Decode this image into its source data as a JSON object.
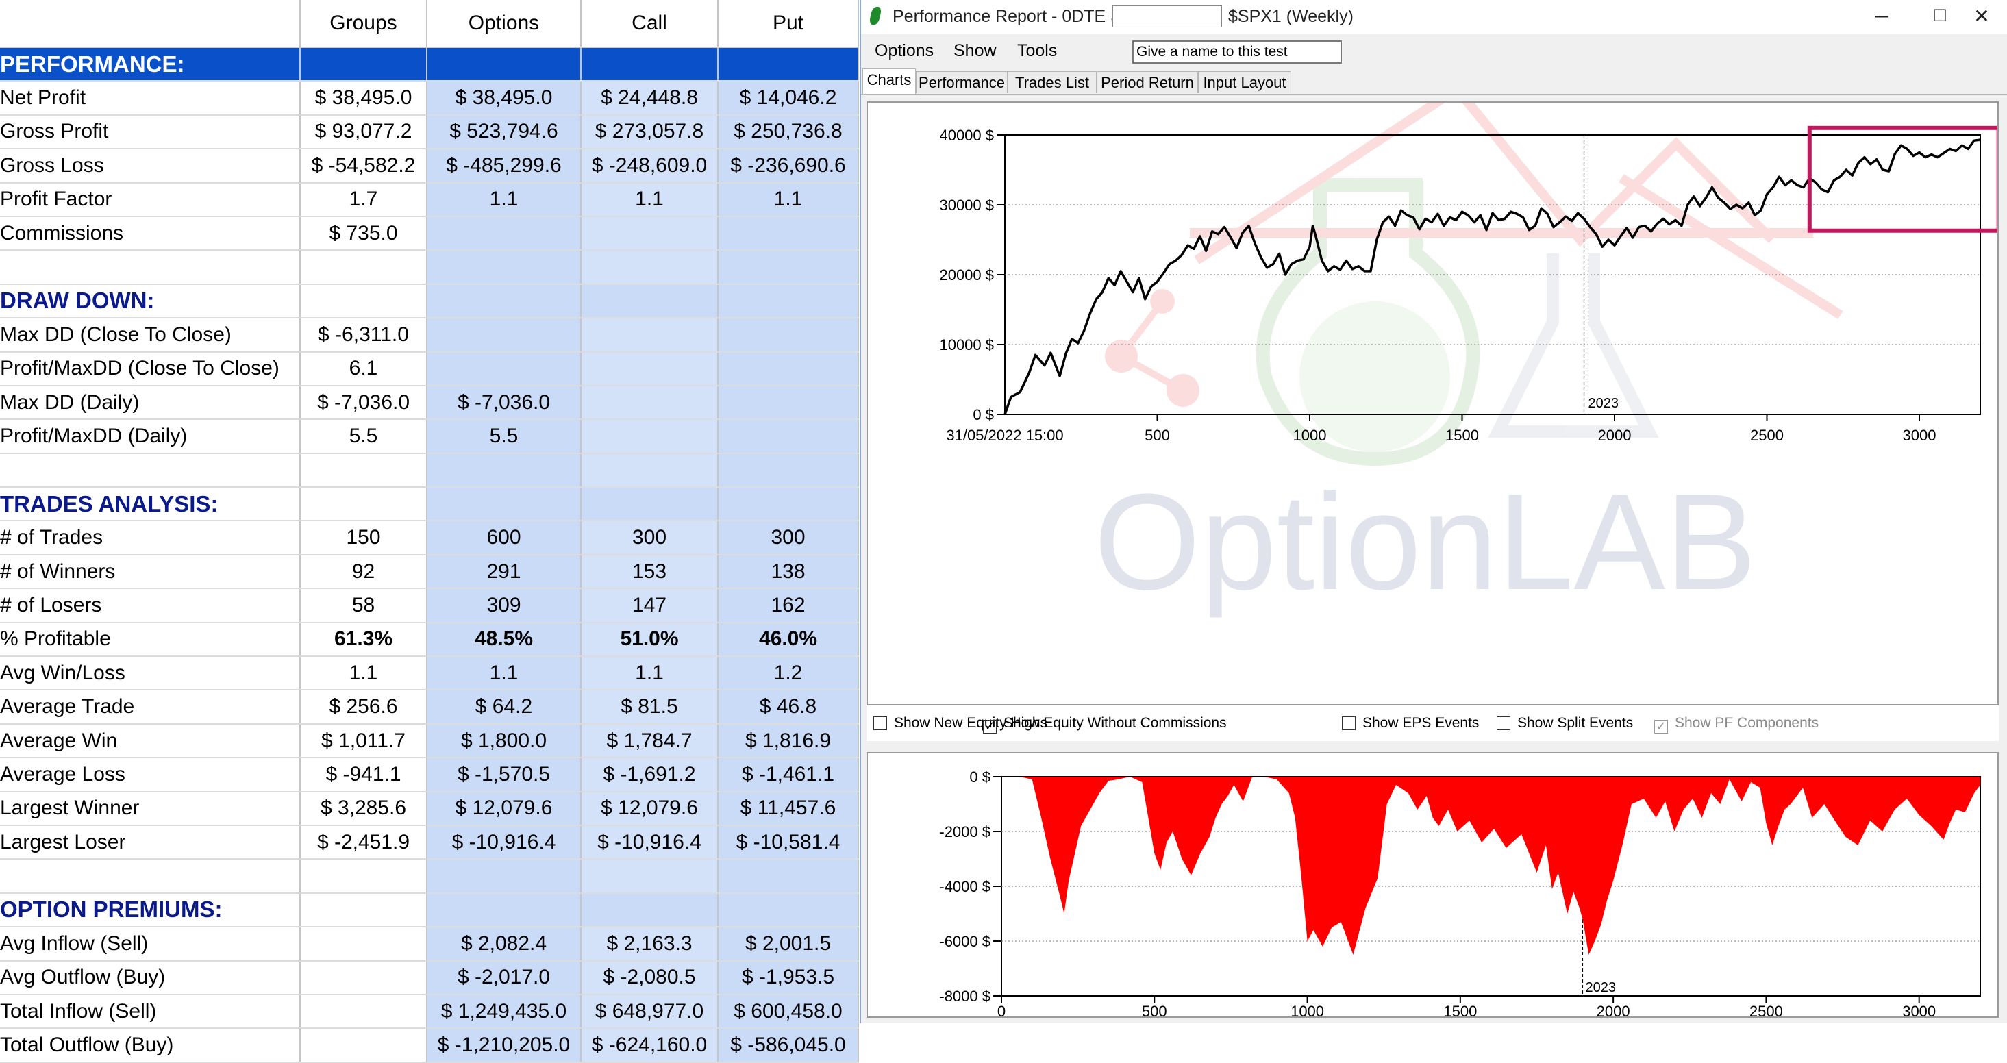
{
  "table": {
    "columns": [
      "",
      "Groups",
      "Options",
      "Call",
      "Put"
    ],
    "rows": [
      {
        "type": "section",
        "style": "perf",
        "label": "PERFORMANCE:",
        "cells": [
          "",
          "",
          "",
          ""
        ]
      },
      {
        "label": "Net Profit",
        "cells": [
          {
            "v": "$ 38,495.0",
            "c": "pos"
          },
          {
            "v": "$ 38,495.0",
            "c": "pos"
          },
          {
            "v": "$ 24,448.8",
            "c": "pos"
          },
          {
            "v": "$ 14,046.2",
            "c": "pos"
          }
        ]
      },
      {
        "label": "Gross Profit",
        "cells": [
          {
            "v": "$ 93,077.2",
            "c": "pos"
          },
          {
            "v": "$ 523,794.6",
            "c": "pos"
          },
          {
            "v": "$ 273,057.8",
            "c": "pos"
          },
          {
            "v": "$ 250,736.8",
            "c": "pos"
          }
        ]
      },
      {
        "label": "Gross Loss",
        "cells": [
          {
            "v": "$ -54,582.2",
            "c": "neg"
          },
          {
            "v": "$ -485,299.6",
            "c": "neg"
          },
          {
            "v": "$ -248,609.0",
            "c": "neg"
          },
          {
            "v": "$ -236,690.6",
            "c": "neg"
          }
        ]
      },
      {
        "label": "Profit Factor",
        "cells": [
          {
            "v": "1.7",
            "c": "pos"
          },
          {
            "v": "1.1",
            "c": "pos"
          },
          {
            "v": "1.1",
            "c": "pos"
          },
          {
            "v": "1.1",
            "c": "pos"
          }
        ]
      },
      {
        "label": "Commissions",
        "cells": [
          {
            "v": "$ 735.0",
            "c": "neg"
          },
          {
            "v": ""
          },
          {
            "v": ""
          },
          {
            "v": ""
          }
        ]
      },
      {
        "type": "blank",
        "label": "",
        "cells": [
          "",
          "",
          "",
          ""
        ]
      },
      {
        "type": "section",
        "label": "DRAW DOWN:",
        "cells": [
          "",
          "",
          "",
          ""
        ]
      },
      {
        "label": "Max DD (Close To Close)",
        "cells": [
          {
            "v": "$ -6,311.0"
          },
          {
            "v": ""
          },
          {
            "v": ""
          },
          {
            "v": ""
          }
        ]
      },
      {
        "label": "Profit/MaxDD (Close To Close)",
        "cells": [
          {
            "v": "6.1"
          },
          {
            "v": ""
          },
          {
            "v": ""
          },
          {
            "v": ""
          }
        ]
      },
      {
        "label": "Max DD (Daily)",
        "cells": [
          {
            "v": "$ -7,036.0"
          },
          {
            "v": "$ -7,036.0"
          },
          {
            "v": ""
          },
          {
            "v": ""
          }
        ]
      },
      {
        "label": "Profit/MaxDD (Daily)",
        "cells": [
          {
            "v": "5.5"
          },
          {
            "v": "5.5"
          },
          {
            "v": ""
          },
          {
            "v": ""
          }
        ]
      },
      {
        "type": "blank",
        "label": "",
        "cells": [
          "",
          "",
          "",
          ""
        ]
      },
      {
        "type": "section",
        "label": "TRADES ANALYSIS:",
        "cells": [
          "",
          "",
          "",
          ""
        ]
      },
      {
        "label": "# of Trades",
        "cells": [
          {
            "v": "150"
          },
          {
            "v": "600"
          },
          {
            "v": "300"
          },
          {
            "v": "300"
          }
        ]
      },
      {
        "label": "# of Winners",
        "cells": [
          {
            "v": "92"
          },
          {
            "v": "291"
          },
          {
            "v": "153"
          },
          {
            "v": "138"
          }
        ]
      },
      {
        "label": "# of Losers",
        "cells": [
          {
            "v": "58"
          },
          {
            "v": "309"
          },
          {
            "v": "147"
          },
          {
            "v": "162"
          }
        ]
      },
      {
        "label": "% Profitable",
        "cells": [
          {
            "v": "61.3%",
            "c": "bold"
          },
          {
            "v": "48.5%",
            "c": "bold"
          },
          {
            "v": "51.0%",
            "c": "bold"
          },
          {
            "v": "46.0%",
            "c": "bold"
          }
        ]
      },
      {
        "label": "Avg Win/Loss",
        "cells": [
          {
            "v": "1.1",
            "c": "pos"
          },
          {
            "v": "1.1",
            "c": "pos"
          },
          {
            "v": "1.1",
            "c": "pos"
          },
          {
            "v": "1.2",
            "c": "pos"
          }
        ]
      },
      {
        "label": "Average Trade",
        "cells": [
          {
            "v": "$ 256.6",
            "c": "pos"
          },
          {
            "v": "$ 64.2",
            "c": "pos"
          },
          {
            "v": "$ 81.5",
            "c": "pos"
          },
          {
            "v": "$ 46.8",
            "c": "pos"
          }
        ]
      },
      {
        "label": "Average Win",
        "cells": [
          {
            "v": "$ 1,011.7",
            "c": "pos"
          },
          {
            "v": "$ 1,800.0",
            "c": "pos"
          },
          {
            "v": "$ 1,784.7",
            "c": "pos"
          },
          {
            "v": "$ 1,816.9",
            "c": "pos"
          }
        ]
      },
      {
        "label": "Average Loss",
        "cells": [
          {
            "v": "$ -941.1",
            "c": "neg"
          },
          {
            "v": "$ -1,570.5",
            "c": "neg"
          },
          {
            "v": "$ -1,691.2",
            "c": "neg"
          },
          {
            "v": "$ -1,461.1",
            "c": "neg"
          }
        ]
      },
      {
        "label": "Largest Winner",
        "cells": [
          {
            "v": "$ 3,285.6",
            "c": "pos"
          },
          {
            "v": "$ 12,079.6",
            "c": "pos"
          },
          {
            "v": "$ 12,079.6",
            "c": "pos"
          },
          {
            "v": "$ 11,457.6",
            "c": "pos"
          }
        ]
      },
      {
        "label": "Largest Loser",
        "cells": [
          {
            "v": "$ -2,451.9",
            "c": "neg"
          },
          {
            "v": "$ -10,916.4",
            "c": "neg"
          },
          {
            "v": "$ -10,916.4",
            "c": "neg"
          },
          {
            "v": "$ -10,581.4",
            "c": "neg"
          }
        ]
      },
      {
        "type": "blank",
        "label": "",
        "cells": [
          "",
          "",
          "",
          ""
        ]
      },
      {
        "type": "section",
        "label": "OPTION PREMIUMS:",
        "cells": [
          "",
          "",
          "",
          ""
        ]
      },
      {
        "label": "Avg Inflow (Sell)",
        "cells": [
          {
            "v": ""
          },
          {
            "v": "$ 2,082.4",
            "c": "pos"
          },
          {
            "v": "$ 2,163.3",
            "c": "pos"
          },
          {
            "v": "$ 2,001.5",
            "c": "pos"
          }
        ]
      },
      {
        "label": "Avg Outflow (Buy)",
        "cells": [
          {
            "v": ""
          },
          {
            "v": "$ -2,017.0",
            "c": "neg"
          },
          {
            "v": "$ -2,080.5",
            "c": "neg"
          },
          {
            "v": "$ -1,953.5",
            "c": "neg"
          }
        ]
      },
      {
        "label": "Total Inflow (Sell)",
        "cells": [
          {
            "v": ""
          },
          {
            "v": "$ 1,249,435.0",
            "c": "pos"
          },
          {
            "v": "$ 648,977.0",
            "c": "pos"
          },
          {
            "v": "$ 600,458.0",
            "c": "pos"
          }
        ]
      },
      {
        "label": "Total Outflow (Buy)",
        "cells": [
          {
            "v": ""
          },
          {
            "v": "$ -1,210,205.0",
            "c": "neg"
          },
          {
            "v": "$ -624,160.0",
            "c": "neg"
          },
          {
            "v": "$ -586,045.0",
            "c": "neg"
          }
        ]
      }
    ]
  },
  "window": {
    "title": "Performance Report - 0DTE SPX",
    "title_suffix": "$SPX1 (Weekly)",
    "minimize": "─",
    "maximize": "☐",
    "close": "✕",
    "menu": [
      "Options",
      "Show",
      "Tools"
    ],
    "test_name": "Give a name to this test",
    "tabs": [
      "Charts",
      "Performance",
      "Trades List",
      "Period Return",
      "Input Layout"
    ],
    "options": [
      {
        "label": "Show New Equity Highs",
        "checked": false,
        "disabled": false
      },
      {
        "label": "Show Equity Without Commissions",
        "checked": true,
        "disabled": false
      },
      {
        "label": "Show EPS Events",
        "checked": false,
        "disabled": false
      },
      {
        "label": "Show Split Events",
        "checked": false,
        "disabled": false
      },
      {
        "label": "Show PF Components",
        "checked": true,
        "disabled": true
      }
    ],
    "watermark": "OptionLAB"
  },
  "colors": {
    "selected_col": "#c9dbf7",
    "header_blue": "#0a50c8",
    "positive": "#0f7a1f",
    "negative": "#e0171f",
    "drawdown": "#ff0000",
    "highlight_box": "#c0185a"
  },
  "chart_data": [
    {
      "type": "line",
      "name": "equity",
      "first_x_label": "31/05/2022 15:00",
      "x_ticks": [
        500,
        1000,
        1500,
        2000,
        2500,
        3000
      ],
      "y_ticks": [
        0,
        10000,
        20000,
        30000,
        40000
      ],
      "y_tick_labels": [
        "0 $",
        "10000 $",
        "20000 $",
        "30000 $",
        "40000 $"
      ],
      "xlim": [
        0,
        3200
      ],
      "ylim": [
        0,
        40000
      ],
      "marker": {
        "x": 1900,
        "label": "2023"
      },
      "highlight": {
        "x": [
          2640,
          3260
        ],
        "y": [
          26300,
          41000
        ]
      },
      "x": [
        0,
        20,
        50,
        80,
        100,
        130,
        150,
        180,
        200,
        220,
        240,
        260,
        280,
        300,
        320,
        340,
        360,
        380,
        400,
        420,
        440,
        460,
        480,
        500,
        520,
        540,
        560,
        580,
        600,
        620,
        640,
        660,
        680,
        700,
        720,
        740,
        760,
        780,
        800,
        820,
        840,
        860,
        880,
        900,
        920,
        940,
        960,
        980,
        1000,
        1010,
        1020,
        1040,
        1060,
        1080,
        1100,
        1120,
        1140,
        1160,
        1180,
        1200,
        1220,
        1240,
        1260,
        1280,
        1300,
        1320,
        1340,
        1360,
        1380,
        1400,
        1420,
        1440,
        1460,
        1480,
        1500,
        1520,
        1540,
        1560,
        1580,
        1600,
        1620,
        1640,
        1660,
        1680,
        1700,
        1720,
        1740,
        1760,
        1780,
        1800,
        1820,
        1840,
        1860,
        1880,
        1900,
        1920,
        1940,
        1960,
        1980,
        2000,
        2020,
        2040,
        2060,
        2080,
        2100,
        2120,
        2140,
        2160,
        2180,
        2200,
        2220,
        2240,
        2260,
        2280,
        2300,
        2320,
        2340,
        2360,
        2380,
        2400,
        2420,
        2440,
        2460,
        2480,
        2500,
        2520,
        2540,
        2560,
        2580,
        2600,
        2620,
        2640,
        2660,
        2680,
        2700,
        2720,
        2740,
        2760,
        2780,
        2800,
        2820,
        2840,
        2860,
        2880,
        2900,
        2920,
        2940,
        2960,
        2980,
        3000,
        3020,
        3040,
        3060,
        3080,
        3100,
        3120,
        3140,
        3160,
        3180,
        3200
      ],
      "y": [
        0,
        2500,
        3200,
        6000,
        8500,
        7000,
        8800,
        5500,
        8700,
        10800,
        10200,
        12000,
        14500,
        16500,
        17500,
        19500,
        18500,
        20500,
        19000,
        17500,
        19500,
        16500,
        18300,
        19000,
        20200,
        21500,
        22000,
        22800,
        24200,
        23700,
        25500,
        23400,
        26200,
        25800,
        26800,
        25400,
        23800,
        26000,
        27000,
        24500,
        22500,
        21000,
        21500,
        23000,
        20000,
        21500,
        22000,
        22200,
        24000,
        27000,
        25500,
        22000,
        20500,
        21200,
        20700,
        22000,
        20800,
        21200,
        20500,
        20500,
        25000,
        27500,
        28300,
        27000,
        29200,
        28500,
        28200,
        26500,
        28000,
        27500,
        28700,
        27000,
        28200,
        27800,
        29000,
        28500,
        27500,
        28500,
        26400,
        28800,
        27800,
        28000,
        29000,
        28700,
        28200,
        26400,
        27000,
        29500,
        28700,
        26800,
        27500,
        28300,
        27700,
        28800,
        28000,
        26800,
        25800,
        24000,
        25000,
        24200,
        25500,
        26700,
        25300,
        26800,
        27000,
        26200,
        27300,
        28000,
        27200,
        27800,
        27000,
        30000,
        31200,
        29800,
        31000,
        32500,
        31000,
        30300,
        29400,
        30000,
        29500,
        30300,
        28500,
        29200,
        31500,
        32500,
        34000,
        32800,
        33500,
        32800,
        32500,
        33800,
        33200,
        32200,
        31800,
        33500,
        34000,
        35000,
        34200,
        36000,
        36800,
        35800,
        36500,
        35000,
        34800,
        37300,
        38500,
        38000,
        37000,
        37500,
        36800,
        37200,
        36800,
        37400,
        38000,
        37700,
        38500,
        38000,
        39200,
        39300
      ]
    },
    {
      "type": "area",
      "name": "drawdown",
      "x_ticks": [
        0,
        500,
        1000,
        1500,
        2000,
        2500,
        3000
      ],
      "y_ticks": [
        0,
        -2000,
        -4000,
        -6000,
        -8000
      ],
      "y_tick_labels": [
        "0 $",
        "-2000 $",
        "-4000 $",
        "-6000 $",
        "-8000 $"
      ],
      "xlim": [
        0,
        3200
      ],
      "ylim": [
        -8000,
        0
      ],
      "marker": {
        "x": 1900,
        "label": "2023"
      },
      "x": [
        0,
        60,
        100,
        130,
        160,
        190,
        205,
        220,
        240,
        260,
        290,
        320,
        350,
        380,
        420,
        460,
        480,
        500,
        520,
        540,
        560,
        590,
        620,
        650,
        680,
        700,
        720,
        740,
        760,
        790,
        820,
        860,
        900,
        940,
        960,
        980,
        1000,
        1020,
        1050,
        1080,
        1110,
        1150,
        1190,
        1230,
        1260,
        1290,
        1330,
        1360,
        1390,
        1410,
        1430,
        1460,
        1490,
        1530,
        1570,
        1610,
        1650,
        1700,
        1750,
        1780,
        1800,
        1820,
        1850,
        1870,
        1890,
        1900,
        1920,
        1940,
        1960,
        1980,
        2000,
        2030,
        2060,
        2100,
        2140,
        2170,
        2200,
        2230,
        2260,
        2290,
        2320,
        2350,
        2380,
        2420,
        2450,
        2480,
        2500,
        2520,
        2540,
        2560,
        2580,
        2600,
        2620,
        2650,
        2690,
        2730,
        2760,
        2800,
        2840,
        2880,
        2920,
        2960,
        3000,
        3040,
        3080,
        3100,
        3120,
        3150,
        3180,
        3200
      ],
      "y": [
        0,
        0,
        -100,
        -1500,
        -3000,
        -4300,
        -5000,
        -3800,
        -2800,
        -1800,
        -1200,
        -600,
        -150,
        -100,
        0,
        -200,
        -1500,
        -2800,
        -3400,
        -2400,
        -2000,
        -3000,
        -3600,
        -2800,
        -2200,
        -1500,
        -1000,
        -700,
        -300,
        -900,
        0,
        0,
        -100,
        -600,
        -1500,
        -3600,
        -6000,
        -5600,
        -6200,
        -5500,
        -5300,
        -6500,
        -4800,
        -3700,
        -1000,
        -300,
        -600,
        -1200,
        -700,
        -1500,
        -1800,
        -1200,
        -2000,
        -1600,
        -2400,
        -1900,
        -2600,
        -2100,
        -3500,
        -2500,
        -4100,
        -3500,
        -5000,
        -4200,
        -4800,
        -5200,
        -6500,
        -6000,
        -5400,
        -4500,
        -3800,
        -2500,
        -1000,
        -800,
        -1500,
        -900,
        -2000,
        -1200,
        -800,
        -1500,
        -600,
        -1000,
        -100,
        -900,
        -200,
        -400,
        -1700,
        -2500,
        -1800,
        -1200,
        -1000,
        -700,
        -400,
        -1500,
        -1000,
        -1700,
        -2200,
        -2500,
        -1600,
        -2000,
        -1200,
        -800,
        -1400,
        -1800,
        -2300,
        -1700,
        -1200,
        -1300,
        -600,
        -300,
        0
      ]
    }
  ]
}
